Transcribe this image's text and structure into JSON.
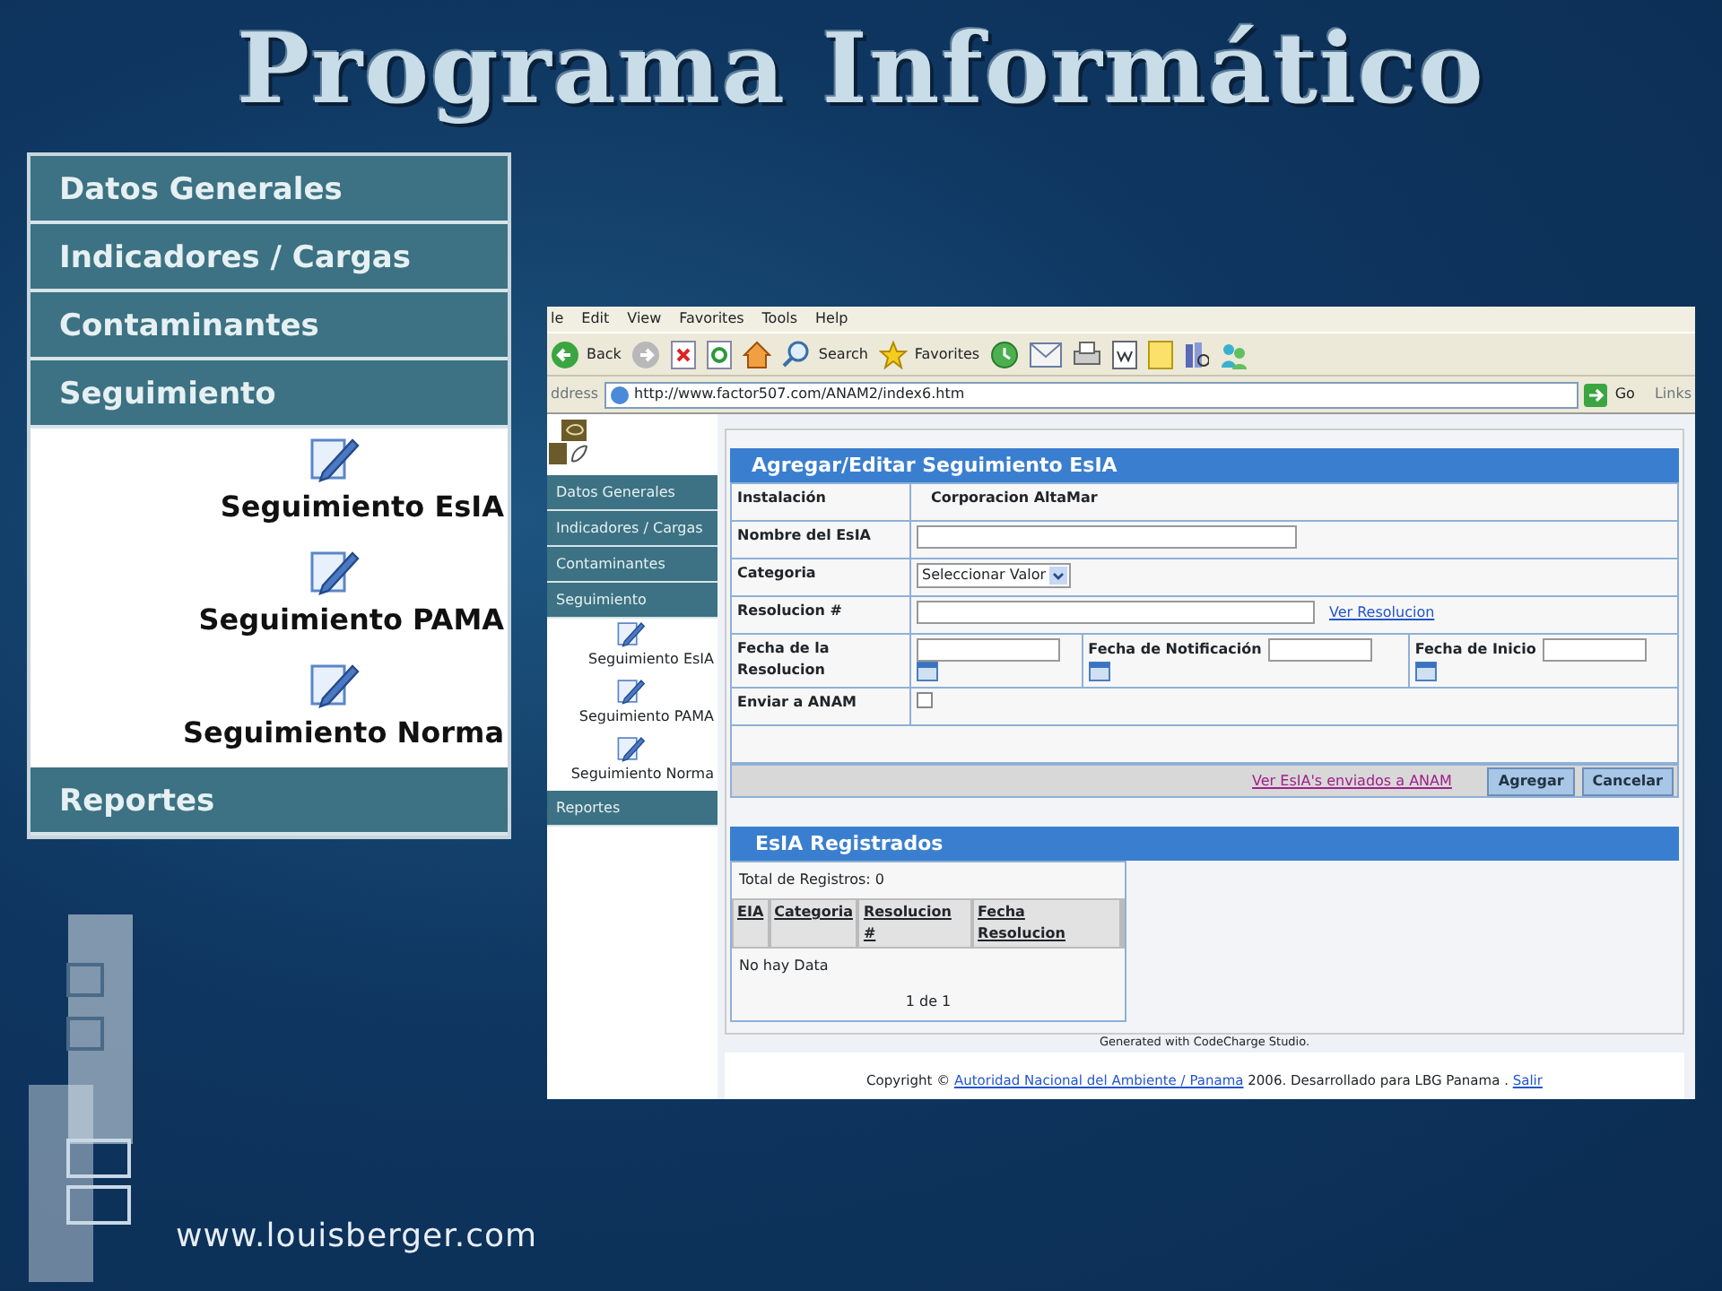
{
  "slide": {
    "title": "Programa Informático",
    "footer_url": "www.louisberger.com"
  },
  "menu_zoom": {
    "items": [
      {
        "kind": "section",
        "label": "Datos Generales"
      },
      {
        "kind": "section",
        "label": "Indicadores / Cargas"
      },
      {
        "kind": "section",
        "label": "Contaminantes"
      },
      {
        "kind": "section",
        "label": "Seguimiento"
      },
      {
        "kind": "subitem",
        "label": "Seguimiento EsIA"
      },
      {
        "kind": "subitem",
        "label": "Seguimiento PAMA"
      },
      {
        "kind": "subitem",
        "label": "Seguimiento Norma"
      },
      {
        "kind": "section",
        "label": "Reportes"
      }
    ]
  },
  "browser": {
    "menu": [
      "le",
      "Edit",
      "View",
      "Favorites",
      "Tools",
      "Help"
    ],
    "toolbar": {
      "back": "Back",
      "search": "Search",
      "favorites": "Favorites"
    },
    "address": {
      "label": "ddress",
      "url": "http://www.factor507.com/ANAM2/index6.htm",
      "go": "Go",
      "links": "Links"
    }
  },
  "app_sidebar": {
    "items": [
      {
        "kind": "section",
        "label": "Datos Generales"
      },
      {
        "kind": "section",
        "label": "Indicadores / Cargas"
      },
      {
        "kind": "section",
        "label": "Contaminantes"
      },
      {
        "kind": "section",
        "label": "Seguimiento"
      },
      {
        "kind": "subitem",
        "label": "Seguimiento EsIA"
      },
      {
        "kind": "subitem",
        "label": "Seguimiento PAMA"
      },
      {
        "kind": "subitem",
        "label": "Seguimiento Norma"
      },
      {
        "kind": "section",
        "label": "Reportes"
      }
    ]
  },
  "form": {
    "title": "Agregar/Editar Seguimiento EsIA",
    "instalacion": {
      "label": "Instalación",
      "value": "Corporacion AltaMar"
    },
    "nombre": {
      "label": "Nombre del EsIA"
    },
    "categoria": {
      "label": "Categoria",
      "value": "Seleccionar Valor"
    },
    "resolucion": {
      "label": "Resolucion #",
      "link": "Ver Resolucion"
    },
    "fechas": [
      {
        "label": "Fecha de la Resolucion"
      },
      {
        "label": "Fecha de Notificación"
      },
      {
        "label": "Fecha de Inicio"
      }
    ],
    "enviar": {
      "label": "Enviar a ANAM",
      "checked": false
    },
    "footer_link": "Ver EsIA's enviados a ANAM",
    "buttons": [
      "Agregar",
      "Cancelar"
    ]
  },
  "grid": {
    "title": "EsIA Registrados",
    "total": "Total de Registros:  0",
    "columns": [
      "EIA",
      "Categoria",
      "Resolucion #",
      "Fecha Resolucion"
    ],
    "empty": "No hay Data",
    "pager": "1 de 1"
  },
  "generated": "Generated with CodeCharge Studio.",
  "copyright": {
    "prefix": "Copyright ©",
    "link": "Autoridad Nacional del Ambiente / Panama",
    "middle": "2006. Desarrollado para LBG Panama .",
    "exit": "Salir"
  }
}
